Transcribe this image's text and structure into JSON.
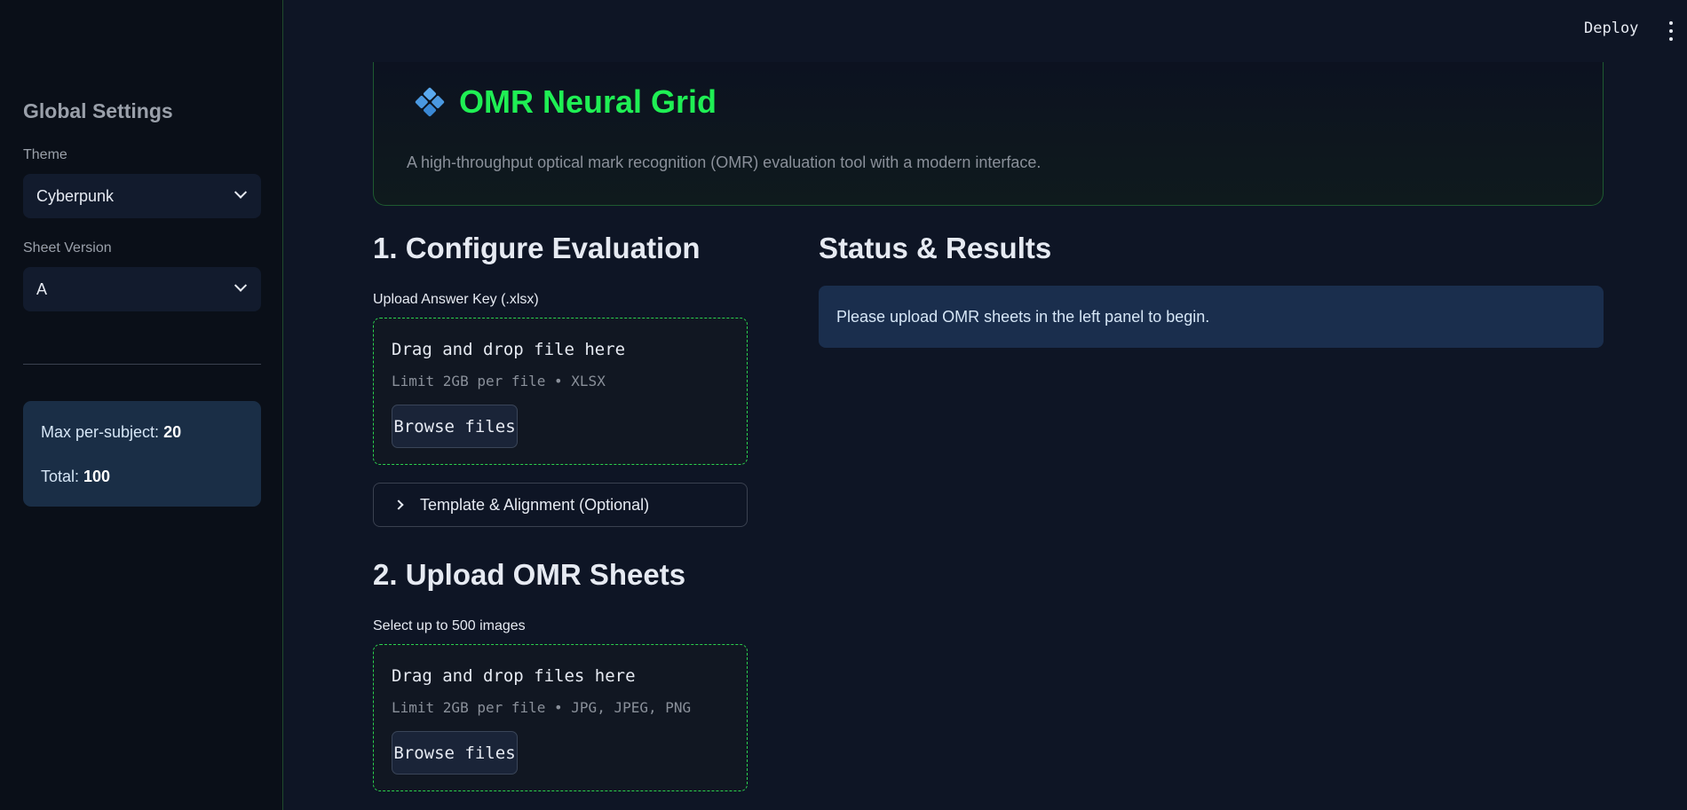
{
  "header": {
    "deploy_label": "Deploy",
    "menu_icon": "kebab-menu-icon"
  },
  "sidebar": {
    "title": "Global Settings",
    "theme": {
      "label": "Theme",
      "value": "Cyberpunk"
    },
    "sheet_version": {
      "label": "Sheet Version",
      "value": "A"
    },
    "info": {
      "max_per_subject_label": "Max per-subject: ",
      "max_per_subject_value": "20",
      "total_label": "Total: ",
      "total_value": "100"
    }
  },
  "hero": {
    "icon": "diamond-grid-icon",
    "title": "OMR Neural Grid",
    "subtitle": "A high-throughput optical mark recognition (OMR) evaluation tool with a modern interface."
  },
  "configure": {
    "heading": "1. Configure Evaluation",
    "answer_key_label": "Upload Answer Key (.xlsx)",
    "dropzone": {
      "title": "Drag and drop file here",
      "limit": "Limit 2GB per file • XLSX",
      "browse_label": "Browse files"
    },
    "expander_label": "Template & Alignment (Optional)"
  },
  "upload": {
    "heading": "2. Upload OMR Sheets",
    "label": "Select up to 500 images",
    "dropzone": {
      "title": "Drag and drop files here",
      "limit": "Limit 2GB per file • JPG, JPEG, PNG",
      "browse_label": "Browse files"
    }
  },
  "status": {
    "heading": "Status & Results",
    "message": "Please upload OMR sheets in the left panel to begin."
  },
  "colors": {
    "accent_green": "#1fef54",
    "dropzone_border": "#2bd24e",
    "info_box": "#1a2e4d",
    "background": "#0e1525",
    "sidebar_background": "#0a0f18"
  }
}
